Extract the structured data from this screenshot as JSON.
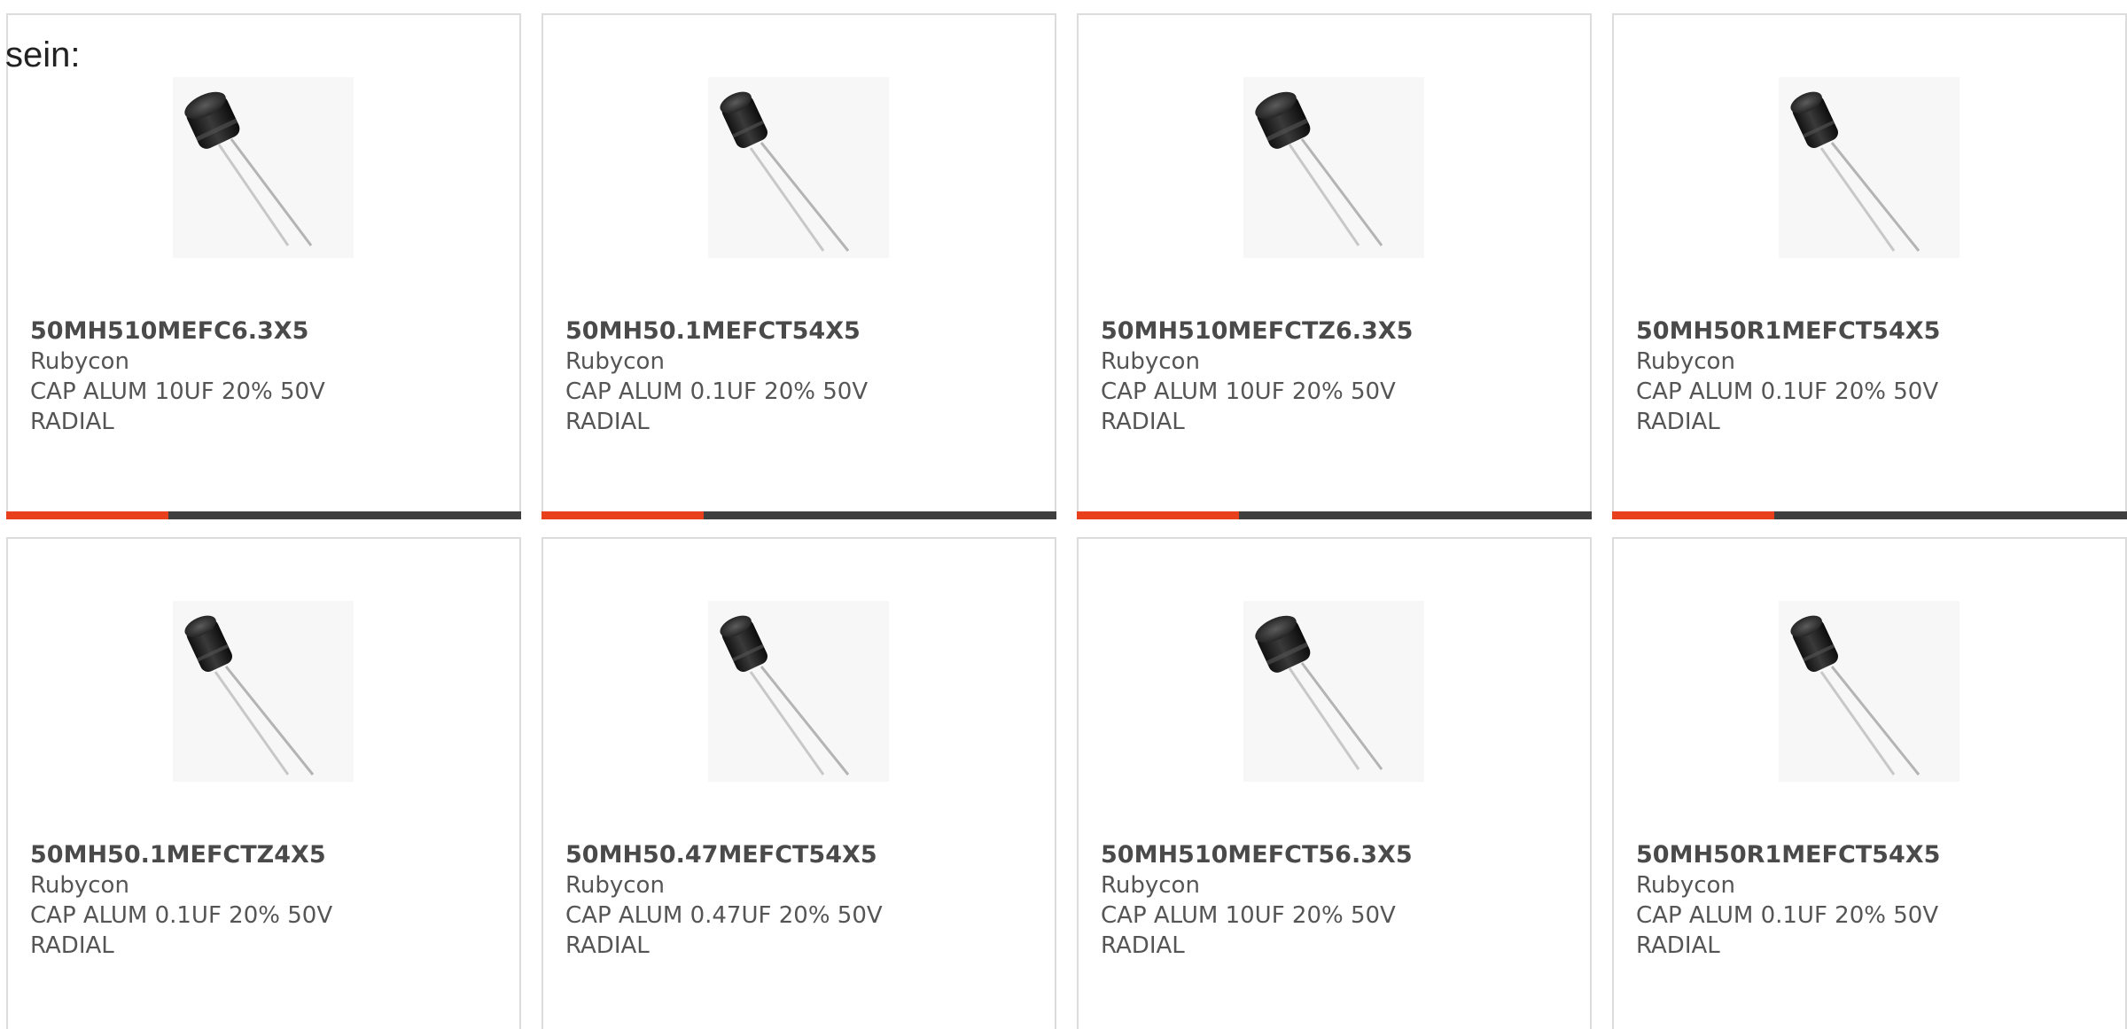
{
  "intro_text": "sein:",
  "colors": {
    "accent": "#e8401c",
    "bar": "#3f3f3f",
    "border": "#dcdcdc",
    "text": "#555555"
  },
  "products": [
    {
      "part_number": "50MH510MEFC6.3X5",
      "manufacturer": "Rubycon",
      "description": "CAP ALUM 10UF 20% 50V RADIAL",
      "image_icon": "capacitor-image"
    },
    {
      "part_number": "50MH50.1MEFCT54X5",
      "manufacturer": "Rubycon",
      "description": "CAP ALUM 0.1UF 20% 50V RADIAL",
      "image_icon": "capacitor-image"
    },
    {
      "part_number": "50MH510MEFCTZ6.3X5",
      "manufacturer": "Rubycon",
      "description": "CAP ALUM 10UF 20% 50V RADIAL",
      "image_icon": "capacitor-image"
    },
    {
      "part_number": "50MH50R1MEFCT54X5",
      "manufacturer": "Rubycon",
      "description": "CAP ALUM 0.1UF 20% 50V RADIAL",
      "image_icon": "capacitor-image"
    },
    {
      "part_number": "50MH50.1MEFCTZ4X5",
      "manufacturer": "Rubycon",
      "description": "CAP ALUM 0.1UF 20% 50V RADIAL",
      "image_icon": "capacitor-image"
    },
    {
      "part_number": "50MH50.47MEFCT54X5",
      "manufacturer": "Rubycon",
      "description": "CAP ALUM 0.47UF 20% 50V RADIAL",
      "image_icon": "capacitor-image"
    },
    {
      "part_number": "50MH510MEFCT56.3X5",
      "manufacturer": "Rubycon",
      "description": "CAP ALUM 10UF 20% 50V RADIAL",
      "image_icon": "capacitor-image"
    },
    {
      "part_number": "50MH50R1MEFCT54X5",
      "manufacturer": "Rubycon",
      "description": "CAP ALUM 0.1UF 20% 50V RADIAL",
      "image_icon": "capacitor-image"
    }
  ]
}
